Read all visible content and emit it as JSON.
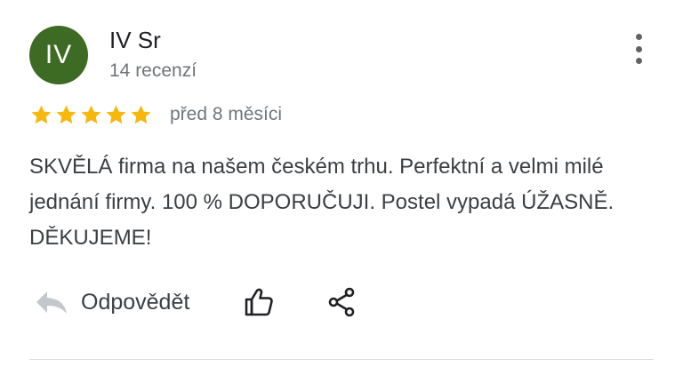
{
  "reviewer": {
    "avatar_initials": "IV",
    "avatar_color": "#3d6b23",
    "name": "IV Sr",
    "review_count": "14 recenzí"
  },
  "more_icon": "more-vertical-icon",
  "rating": {
    "stars": 5,
    "max": 5,
    "star_color": "#f6b80d",
    "time_ago": "před 8 měsíci"
  },
  "review_text": "SKVĚLÁ firma na našem českém trhu. Perfektní a velmi milé jednání firmy. 100 % DOPORUČUJI. Postel vypadá ÚŽASNĚ. DĚKUJEME!",
  "actions": {
    "reply_label": "Odpovědět",
    "reply_icon": "reply-arrow-icon",
    "like_icon": "thumbs-up-icon",
    "share_icon": "share-icon"
  }
}
